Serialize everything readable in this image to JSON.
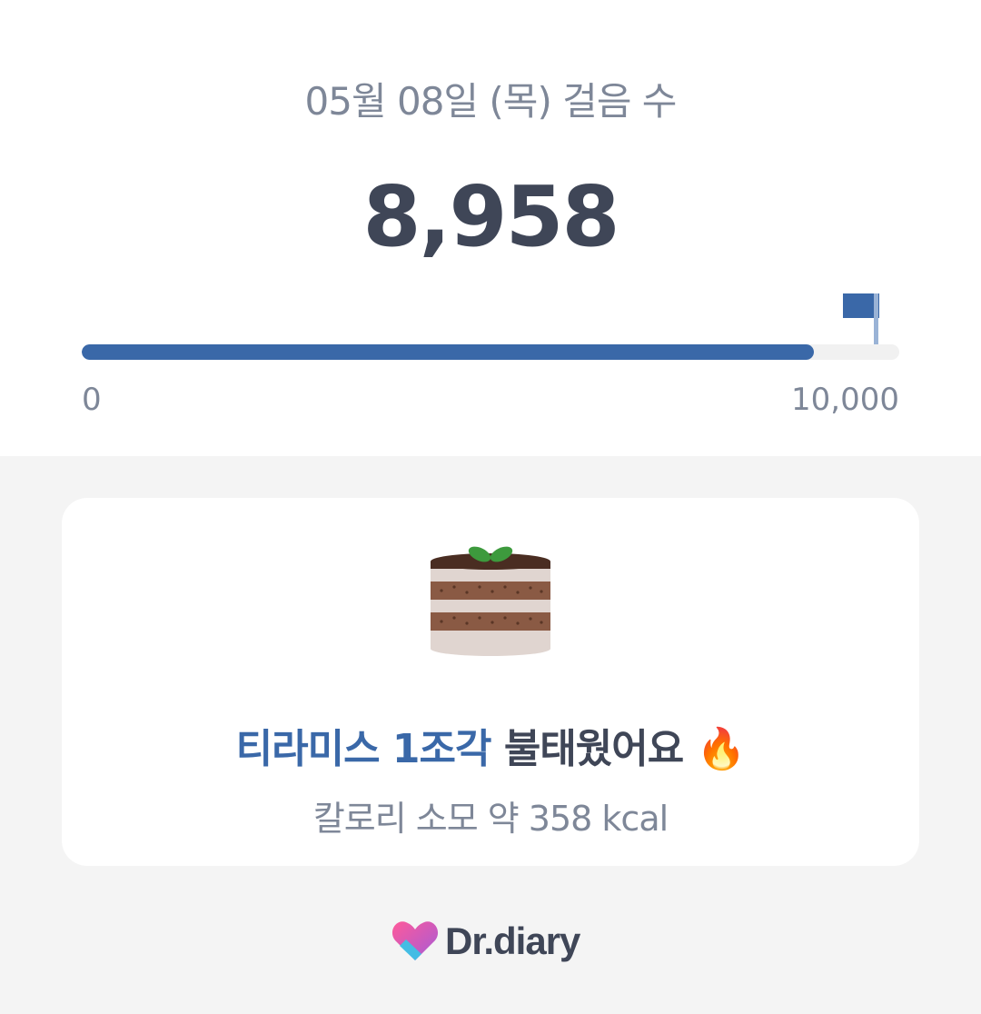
{
  "header": {
    "date_title": "05월 08일 (목) 걸음 수",
    "steps": "8,958"
  },
  "progress": {
    "current": 8958,
    "goal": 10000,
    "min_label": "0",
    "max_label": "10,000",
    "fill_color": "#3a68a8"
  },
  "burn_card": {
    "icon": "tiramisu-cake-icon",
    "food": "티라미스 1조각",
    "action": "불태웠어요",
    "emoji": "🔥",
    "calorie_text": "칼로리 소모 약 358 kcal"
  },
  "brand": {
    "name": "Dr.diary",
    "logo": "heart-logo-icon"
  },
  "colors": {
    "accent": "#3a68a8",
    "text_dark": "#3f4657",
    "text_muted": "#7e8798",
    "background": "#f4f4f4"
  }
}
